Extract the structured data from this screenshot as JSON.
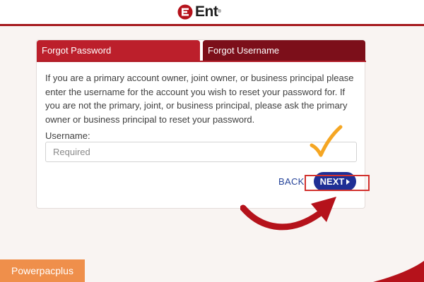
{
  "header": {
    "logo_text": "Ent",
    "logo_trademark": "®",
    "brand_color": "#a5171b"
  },
  "tabs": [
    {
      "label": "Forgot Password",
      "active": true,
      "color": "#bc1f2b"
    },
    {
      "label": "Forgot Username",
      "active": false,
      "color": "#7c0f1a"
    }
  ],
  "form": {
    "description": "If you are a primary account owner, joint owner, or business principal please enter the username for the account you wish to reset your password for. If you are not the primary, joint, or business principal, please ask the primary owner or business principal to reset your password.",
    "username_label": "Username:",
    "username_placeholder": "Required",
    "username_value": ""
  },
  "actions": {
    "back_label": "BACK",
    "next_label": "NEXT",
    "next_color": "#1f2f95"
  },
  "annotations": {
    "checkmark_color": "#f5a623",
    "highlight_color": "#d2322e",
    "arrow_color": "#b5121b"
  },
  "watermark": {
    "text": "Powerpacplus",
    "color": "#ef8f4b"
  }
}
